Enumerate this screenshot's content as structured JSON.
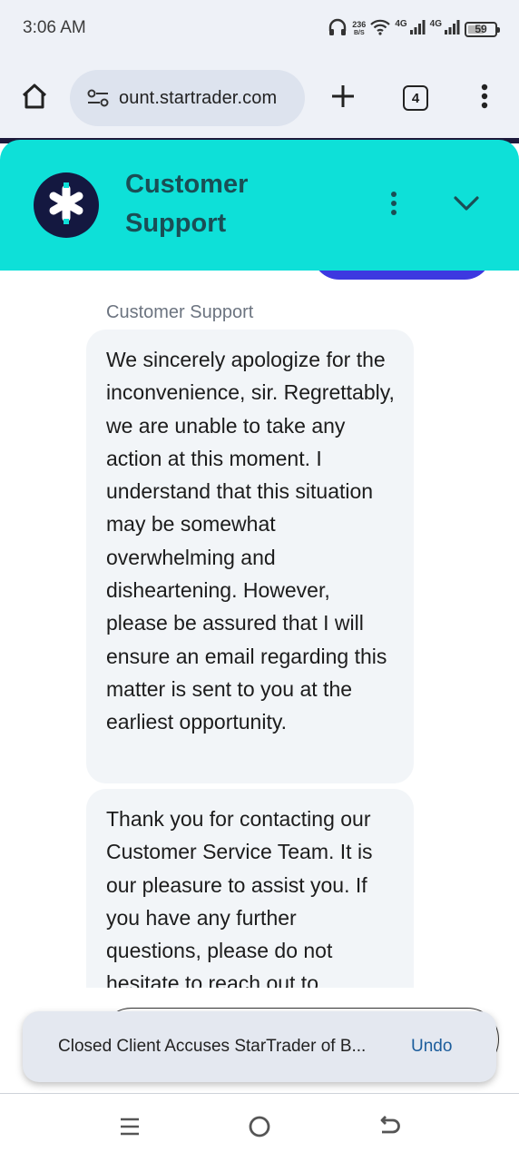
{
  "status_bar": {
    "time": "3:06 AM",
    "net_speed_value": "236",
    "net_speed_unit": "B/S",
    "network_1": "4G",
    "network_2": "4G",
    "battery_level": "59",
    "battery_fraction": 0.59
  },
  "browser": {
    "url": "ount.startrader.com",
    "tab_count": "4"
  },
  "chat": {
    "header_title": "Customer Support",
    "accent_color": "#0ee0d8",
    "sender_label": "Customer Support",
    "messages": [
      "We sincerely apologize for the inconvenience, sir. Regrettably, we are unable to take any action at this moment. I understand that this situation may be somewhat overwhelming and disheartening. However, please be assured that I will ensure an email regarding this matter is sent to you at the earliest opportunity.",
      "Thank you for contacting our Customer Service Team. It is our pleasure to assist you. If you have any further questions, please do not hesitate to reach out to"
    ]
  },
  "snackbar": {
    "text": "Closed Client Accuses StarTrader of B...",
    "action": "Undo"
  },
  "icons": {
    "home": "home-icon",
    "site_settings": "tune-icon",
    "new_tab": "plus-icon",
    "menu": "more-vert-icon",
    "chevron": "chevron-down-icon",
    "nav_recents": "recents-icon",
    "nav_home": "circle-home-icon",
    "nav_back": "back-icon"
  }
}
